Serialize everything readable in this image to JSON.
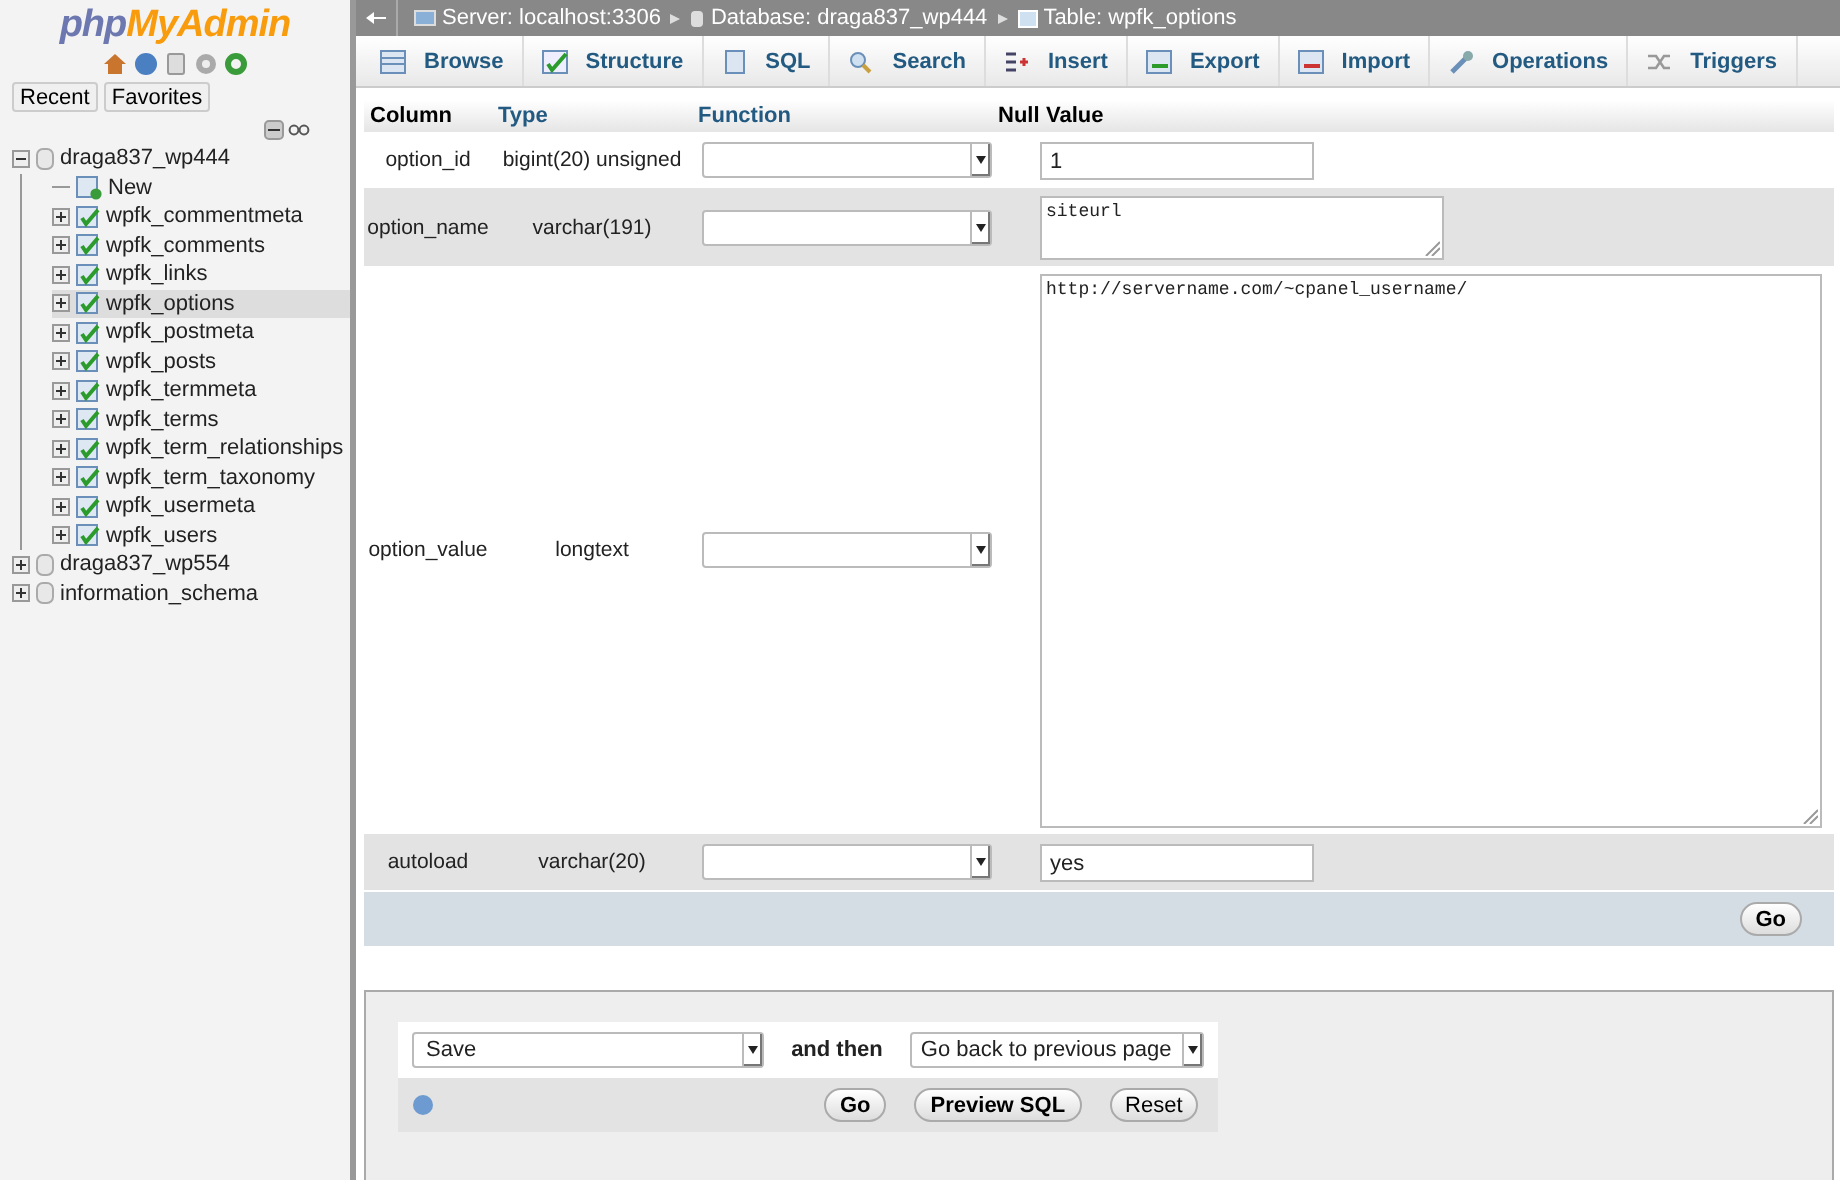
{
  "logo": {
    "part_1": "php",
    "part_2": "MyAdmin"
  },
  "sidebar": {
    "buttons": [
      "Recent",
      "Favorites"
    ],
    "tree": [
      {
        "label": "draga837_wp444",
        "kind": "database",
        "expanded": true,
        "selected": false,
        "children": [
          {
            "label": "New",
            "kind": "new",
            "selected": false
          },
          {
            "label": "wpfk_commentmeta",
            "kind": "table",
            "expanded": false,
            "selected": false
          },
          {
            "label": "wpfk_comments",
            "kind": "table",
            "expanded": false,
            "selected": false
          },
          {
            "label": "wpfk_links",
            "kind": "table",
            "expanded": false,
            "selected": false
          },
          {
            "label": "wpfk_options",
            "kind": "table",
            "expanded": false,
            "selected": true
          },
          {
            "label": "wpfk_postmeta",
            "kind": "table",
            "expanded": false,
            "selected": false
          },
          {
            "label": "wpfk_posts",
            "kind": "table",
            "expanded": false,
            "selected": false
          },
          {
            "label": "wpfk_termmeta",
            "kind": "table",
            "expanded": false,
            "selected": false
          },
          {
            "label": "wpfk_terms",
            "kind": "table",
            "expanded": false,
            "selected": false
          },
          {
            "label": "wpfk_term_relationships",
            "kind": "table",
            "expanded": false,
            "selected": false
          },
          {
            "label": "wpfk_term_taxonomy",
            "kind": "table",
            "expanded": false,
            "selected": false
          },
          {
            "label": "wpfk_usermeta",
            "kind": "table",
            "expanded": false,
            "selected": false
          },
          {
            "label": "wpfk_users",
            "kind": "table",
            "expanded": false,
            "selected": false
          }
        ]
      },
      {
        "label": "draga837_wp554",
        "kind": "database",
        "expanded": false,
        "selected": false
      },
      {
        "label": "information_schema",
        "kind": "database",
        "expanded": false,
        "selected": false
      }
    ]
  },
  "breadcrumb": [
    {
      "kind": "server",
      "text": "Server: localhost:3306"
    },
    {
      "kind": "database",
      "text": "Database: draga837_wp444"
    },
    {
      "kind": "table",
      "text": "Table: wpfk_options"
    }
  ],
  "tabs": [
    {
      "label": "Browse"
    },
    {
      "label": "Structure"
    },
    {
      "label": "SQL"
    },
    {
      "label": "Search"
    },
    {
      "label": "Insert"
    },
    {
      "label": "Export"
    },
    {
      "label": "Import"
    },
    {
      "label": "Operations"
    },
    {
      "label": "Triggers"
    }
  ],
  "table": {
    "columns": [
      "Column",
      "Type",
      "Function",
      "Null",
      "Value"
    ],
    "rows": [
      {
        "column": "option_id",
        "type": "bigint(20) unsigned",
        "kind": "input",
        "value": "1"
      },
      {
        "column": "option_name",
        "type": "varchar(191)",
        "kind": "textarea",
        "value": "siteurl"
      },
      {
        "column": "option_value",
        "type": "longtext",
        "kind": "large_textarea",
        "value": "http://servername.com/~cpanel_username/"
      },
      {
        "column": "autoload",
        "type": "varchar(20)",
        "kind": "input",
        "value": "yes"
      }
    ],
    "go_button": "Go"
  },
  "footer": {
    "action": "Save",
    "and_then": "and then",
    "after": "Go back to previous page",
    "buttons": [
      "Go",
      "Preview SQL",
      "Reset"
    ]
  }
}
